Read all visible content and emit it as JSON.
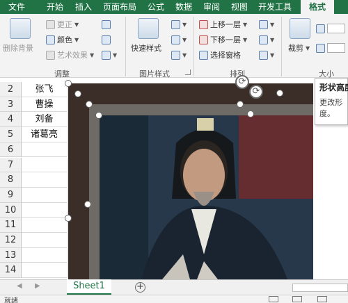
{
  "tabs": [
    {
      "label": "文件"
    },
    {
      "label": "开始"
    },
    {
      "label": "插入"
    },
    {
      "label": "页面布局"
    },
    {
      "label": "公式"
    },
    {
      "label": "数据"
    },
    {
      "label": "审阅"
    },
    {
      "label": "视图"
    },
    {
      "label": "开发工具"
    },
    {
      "label": "格式"
    }
  ],
  "ribbon": {
    "remove_bg": "删除背景",
    "correct": "更正",
    "color": "颜色",
    "artistic": "艺术效果",
    "adjust_group": "调整",
    "quick_styles": "快速样式",
    "picture_styles_group": "图片样式",
    "bring_forward": "上移一层",
    "send_backward": "下移一层",
    "selection_pane": "选择窗格",
    "arrange_group": "排列",
    "crop": "裁剪",
    "size_group": "大小"
  },
  "tooltip": {
    "title": "形状高度",
    "body_line1": "更改形状",
    "body_line2": "度。"
  },
  "rows": [
    {
      "num": "2",
      "value": "张飞"
    },
    {
      "num": "3",
      "value": "曹操"
    },
    {
      "num": "4",
      "value": "刘备"
    },
    {
      "num": "5",
      "value": "诸葛亮"
    },
    {
      "num": "6",
      "value": ""
    },
    {
      "num": "7",
      "value": ""
    },
    {
      "num": "8",
      "value": ""
    },
    {
      "num": "9",
      "value": ""
    },
    {
      "num": "10",
      "value": ""
    },
    {
      "num": "11",
      "value": ""
    },
    {
      "num": "12",
      "value": ""
    },
    {
      "num": "13",
      "value": ""
    },
    {
      "num": "14",
      "value": ""
    }
  ],
  "sheet": {
    "tab_label": "Sheet1",
    "add_label": "+"
  },
  "status": {
    "text": "就绪"
  },
  "colors": {
    "accent": "#217346"
  }
}
